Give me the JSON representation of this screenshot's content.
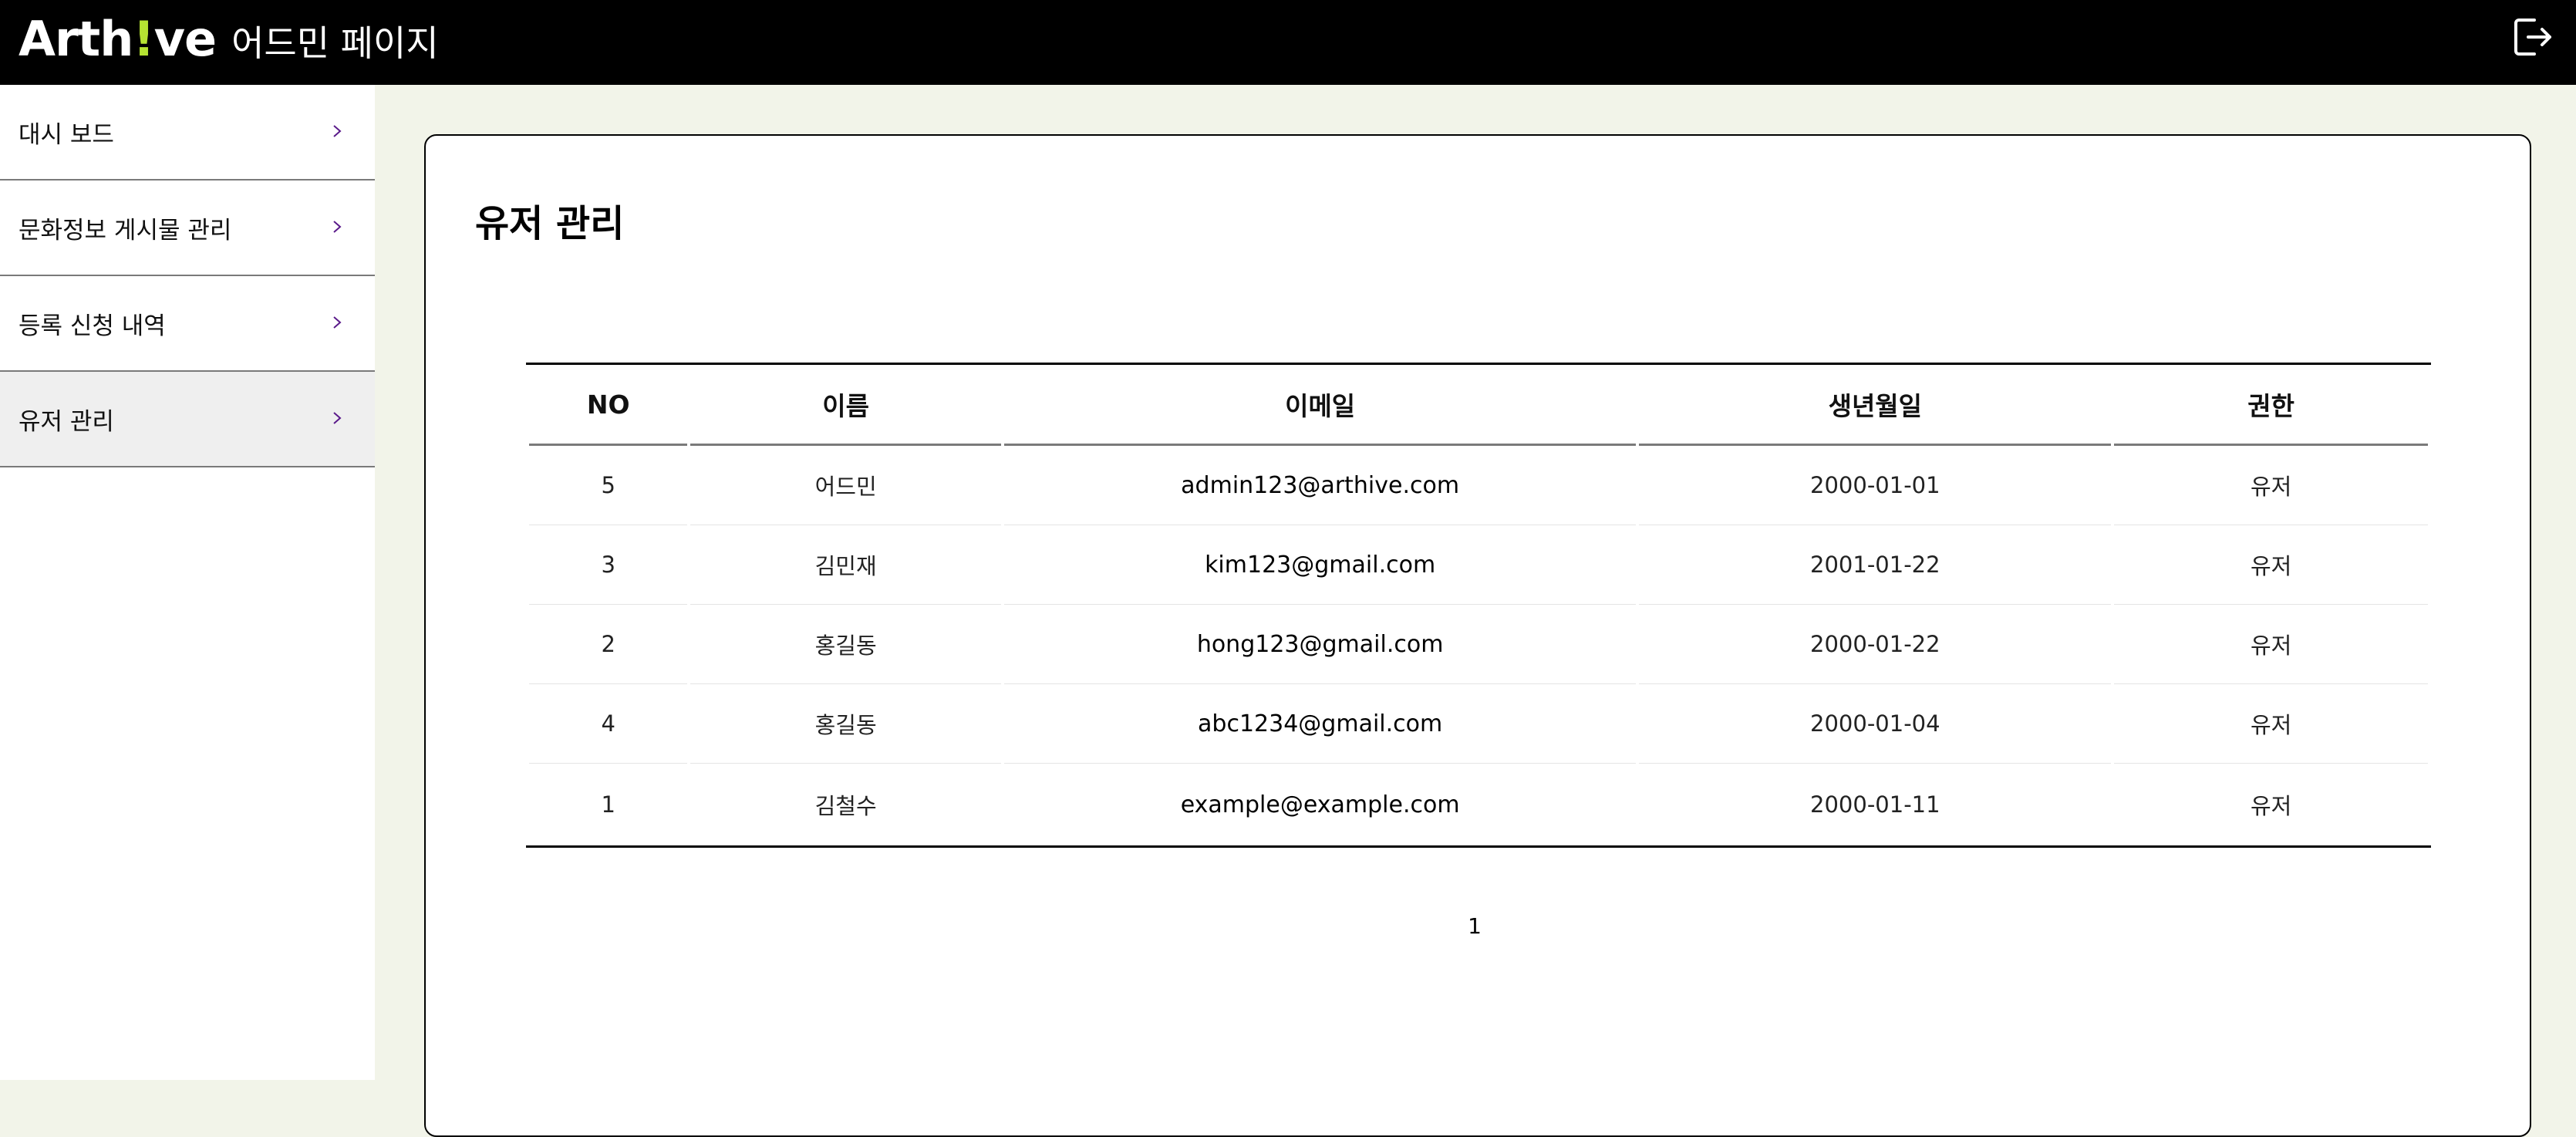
{
  "header": {
    "logo_prefix": "Arth",
    "logo_bang": "!",
    "logo_suffix": "ve",
    "subtitle": "어드민 페이지",
    "logout_icon": "logout-icon",
    "accent_color": "#b5e332"
  },
  "sidebar": {
    "items": [
      {
        "label": "대시 보드"
      },
      {
        "label": "문화정보 게시물 관리"
      },
      {
        "label": "등록 신청 내역"
      },
      {
        "label": "유저 관리"
      }
    ],
    "active_index": 3,
    "chevron_color": "#5a1a8a"
  },
  "main": {
    "title": "유저 관리",
    "table": {
      "columns": [
        "NO",
        "이름",
        "이메일",
        "생년월일",
        "권한"
      ],
      "rows": [
        {
          "no": "5",
          "name": "어드민",
          "email": "admin123@arthive.com",
          "birth": "2000-01-01",
          "role": "유저"
        },
        {
          "no": "3",
          "name": "김민재",
          "email": "kim123@gmail.com",
          "birth": "2001-01-22",
          "role": "유저"
        },
        {
          "no": "2",
          "name": "홍길동",
          "email": "hong123@gmail.com",
          "birth": "2000-01-22",
          "role": "유저"
        },
        {
          "no": "4",
          "name": "홍길동",
          "email": "abc1234@gmail.com",
          "birth": "2000-01-04",
          "role": "유저"
        },
        {
          "no": "1",
          "name": "김철수",
          "email": "example@example.com",
          "birth": "2000-01-11",
          "role": "유저"
        }
      ]
    },
    "pagination": {
      "current_page": "1"
    }
  }
}
